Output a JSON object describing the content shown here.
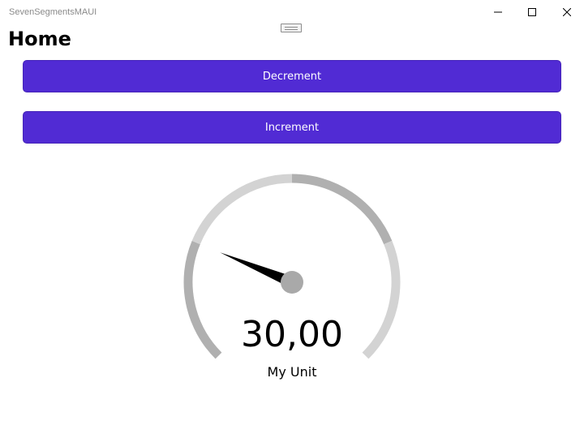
{
  "window": {
    "title": "SevenSegmentsMAUI"
  },
  "page": {
    "title": "Home"
  },
  "buttons": {
    "decrement_label": "Decrement",
    "increment_label": "Increment",
    "accent_color": "#512bd4"
  },
  "gauge": {
    "value_text": "30,00",
    "unit": "My Unit",
    "value_fraction": 0.25,
    "segment_colors": [
      "#b0b0b0",
      "#d3d3d3",
      "#b0b0b0",
      "#d3d3d3"
    ],
    "needle_color": "#000000",
    "hub_color": "#a9a9a9"
  },
  "icons": {
    "minimize": "minimize-icon",
    "maximize": "maximize-icon",
    "close": "close-icon",
    "drag": "drag-handle-icon"
  }
}
